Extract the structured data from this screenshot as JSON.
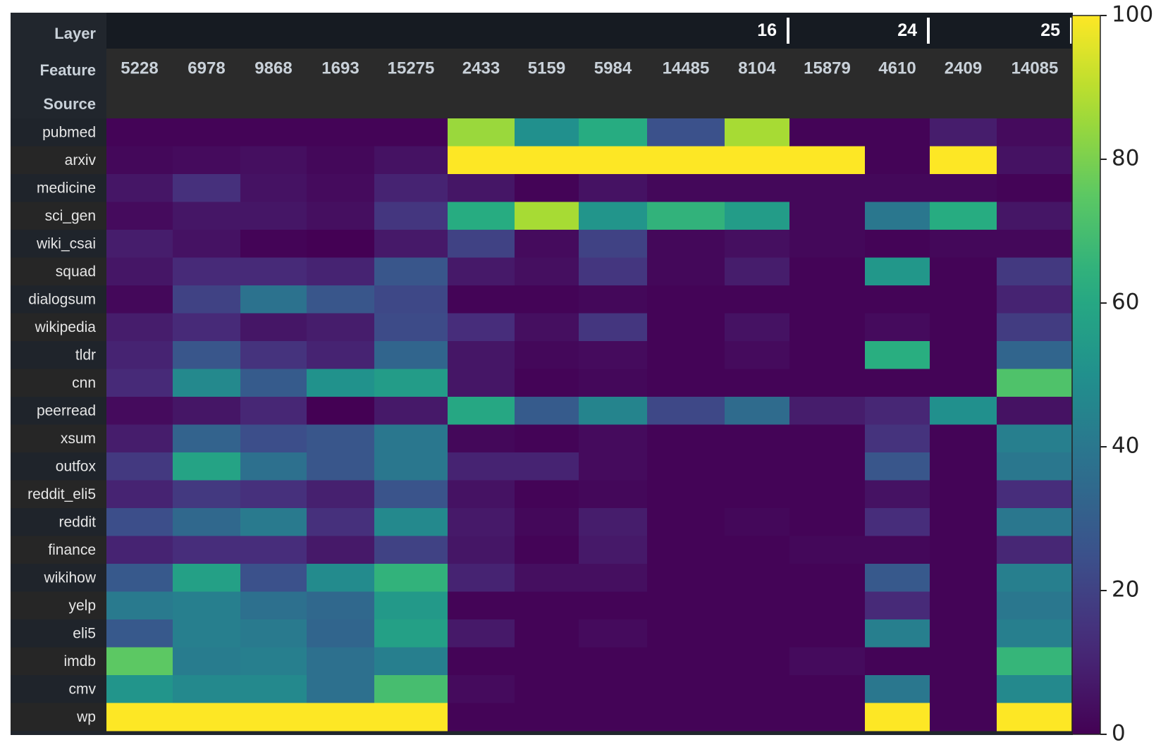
{
  "chart_data": {
    "type": "heatmap",
    "header_labels": {
      "layer": "Layer",
      "feature": "Feature",
      "source": "Source"
    },
    "layers": [
      "16",
      "24",
      "25"
    ],
    "features": [
      "5228",
      "6978",
      "9868",
      "1693",
      "15275",
      "2433",
      "5159",
      "5984",
      "14485",
      "8104",
      "15879",
      "4610",
      "2409",
      "14085"
    ],
    "sources": [
      "pubmed",
      "arxiv",
      "medicine",
      "sci_gen",
      "wiki_csai",
      "squad",
      "dialogsum",
      "wikipedia",
      "tldr",
      "cnn",
      "peerread",
      "xsum",
      "outfox",
      "reddit_eli5",
      "reddit",
      "finance",
      "wikihow",
      "yelp",
      "eli5",
      "imdb",
      "cmv",
      "wp"
    ],
    "values": [
      [
        1,
        1,
        1,
        1,
        1,
        85,
        50,
        62,
        25,
        87,
        1,
        1,
        8,
        3
      ],
      [
        2,
        3,
        4,
        2,
        5,
        100,
        100,
        100,
        100,
        100,
        100,
        1,
        100,
        5
      ],
      [
        6,
        14,
        5,
        3,
        10,
        6,
        1,
        5,
        2,
        2,
        2,
        2,
        2,
        1
      ],
      [
        3,
        6,
        6,
        4,
        16,
        62,
        87,
        52,
        65,
        55,
        2,
        40,
        62,
        6
      ],
      [
        8,
        5,
        1,
        0,
        7,
        20,
        3,
        20,
        2,
        4,
        2,
        1,
        2,
        2
      ],
      [
        6,
        12,
        12,
        10,
        27,
        7,
        4,
        16,
        2,
        8,
        1,
        53,
        1,
        17
      ],
      [
        2,
        20,
        38,
        27,
        22,
        1,
        1,
        2,
        1,
        1,
        1,
        1,
        1,
        10
      ],
      [
        8,
        12,
        6,
        8,
        23,
        13,
        4,
        16,
        1,
        5,
        1,
        3,
        1,
        18
      ],
      [
        10,
        27,
        15,
        10,
        33,
        6,
        2,
        3,
        1,
        3,
        1,
        63,
        1,
        33
      ],
      [
        12,
        47,
        29,
        51,
        55,
        6,
        1,
        2,
        1,
        1,
        1,
        1,
        1,
        72
      ],
      [
        3,
        6,
        11,
        0,
        7,
        60,
        29,
        45,
        22,
        35,
        8,
        11,
        50,
        5
      ],
      [
        8,
        32,
        24,
        27,
        40,
        2,
        1,
        3,
        1,
        1,
        1,
        15,
        1,
        43
      ],
      [
        17,
        58,
        37,
        27,
        40,
        10,
        10,
        3,
        1,
        1,
        1,
        27,
        1,
        40
      ],
      [
        10,
        17,
        14,
        9,
        26,
        5,
        1,
        2,
        1,
        1,
        1,
        5,
        1,
        13
      ],
      [
        24,
        34,
        41,
        14,
        47,
        7,
        2,
        8,
        1,
        2,
        1,
        13,
        1,
        40
      ],
      [
        10,
        13,
        13,
        7,
        20,
        6,
        1,
        7,
        1,
        1,
        2,
        2,
        1,
        11
      ],
      [
        28,
        57,
        25,
        48,
        65,
        10,
        4,
        4,
        1,
        1,
        1,
        28,
        1,
        43
      ],
      [
        41,
        43,
        37,
        34,
        54,
        1,
        1,
        1,
        1,
        1,
        1,
        12,
        1,
        40
      ],
      [
        28,
        43,
        41,
        33,
        57,
        7,
        1,
        3,
        1,
        1,
        1,
        43,
        1,
        43
      ],
      [
        75,
        42,
        43,
        37,
        43,
        1,
        1,
        1,
        1,
        1,
        3,
        1,
        1,
        66
      ],
      [
        52,
        47,
        47,
        37,
        70,
        3,
        1,
        1,
        1,
        1,
        1,
        40,
        1,
        47
      ],
      [
        100,
        100,
        100,
        100,
        100,
        1,
        1,
        1,
        1,
        1,
        1,
        100,
        1,
        100
      ]
    ],
    "colorbar": {
      "min": 0,
      "max": 100,
      "ticks": [
        0,
        20,
        40,
        60,
        80,
        100
      ],
      "colormap": "viridis"
    },
    "colors": {
      "header_bg": "#161b22",
      "row_bg": "#21262d",
      "feature_row_bg": "#2b2b2b"
    }
  }
}
